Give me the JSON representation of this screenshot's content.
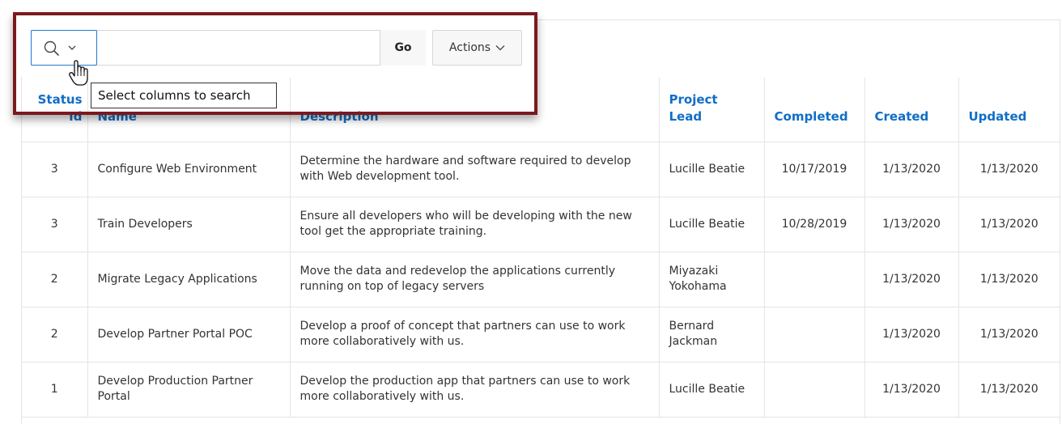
{
  "toolbar": {
    "search_placeholder": "",
    "go_label": "Go",
    "actions_label": "Actions",
    "tooltip": "Select columns to search"
  },
  "table": {
    "columns": [
      "Status Id",
      "Name",
      "Description",
      "Project Lead",
      "Completed",
      "Created",
      "Updated"
    ],
    "rows": [
      {
        "status": "3",
        "name": "Configure Web Environment",
        "description": "Determine the hardware and software required to develop with Web development tool.",
        "lead": "Lucille Beatie",
        "completed": "10/17/2019",
        "created": "1/13/2020",
        "updated": "1/13/2020"
      },
      {
        "status": "3",
        "name": "Train Developers",
        "description": "Ensure all developers who will be developing with the new tool get the appropriate training.",
        "lead": "Lucille Beatie",
        "completed": "10/28/2019",
        "created": "1/13/2020",
        "updated": "1/13/2020"
      },
      {
        "status": "2",
        "name": "Migrate Legacy Applications",
        "description": "Move the data and redevelop the applications currently running on top of legacy servers",
        "lead": "Miyazaki Yokohama",
        "completed": "",
        "created": "1/13/2020",
        "updated": "1/13/2020"
      },
      {
        "status": "2",
        "name": "Develop Partner Portal POC",
        "description": "Develop a proof of concept that partners can use to work more collaboratively with us.",
        "lead": "Bernard Jackman",
        "completed": "",
        "created": "1/13/2020",
        "updated": "1/13/2020"
      },
      {
        "status": "1",
        "name": "Develop Production Partner Portal",
        "description": "Develop the production app that partners can use to work more collaboratively with us.",
        "lead": "Lucille Beatie",
        "completed": "",
        "created": "1/13/2020",
        "updated": "1/13/2020"
      }
    ]
  },
  "icons": {
    "search": "magnifier-icon",
    "chevron": "chevron-down-icon",
    "cursor": "hand-pointer-icon"
  },
  "colors": {
    "header_link": "#0f6ec6",
    "highlight_outline": "#7b1a1f",
    "focus_border": "#1f7ad1"
  }
}
